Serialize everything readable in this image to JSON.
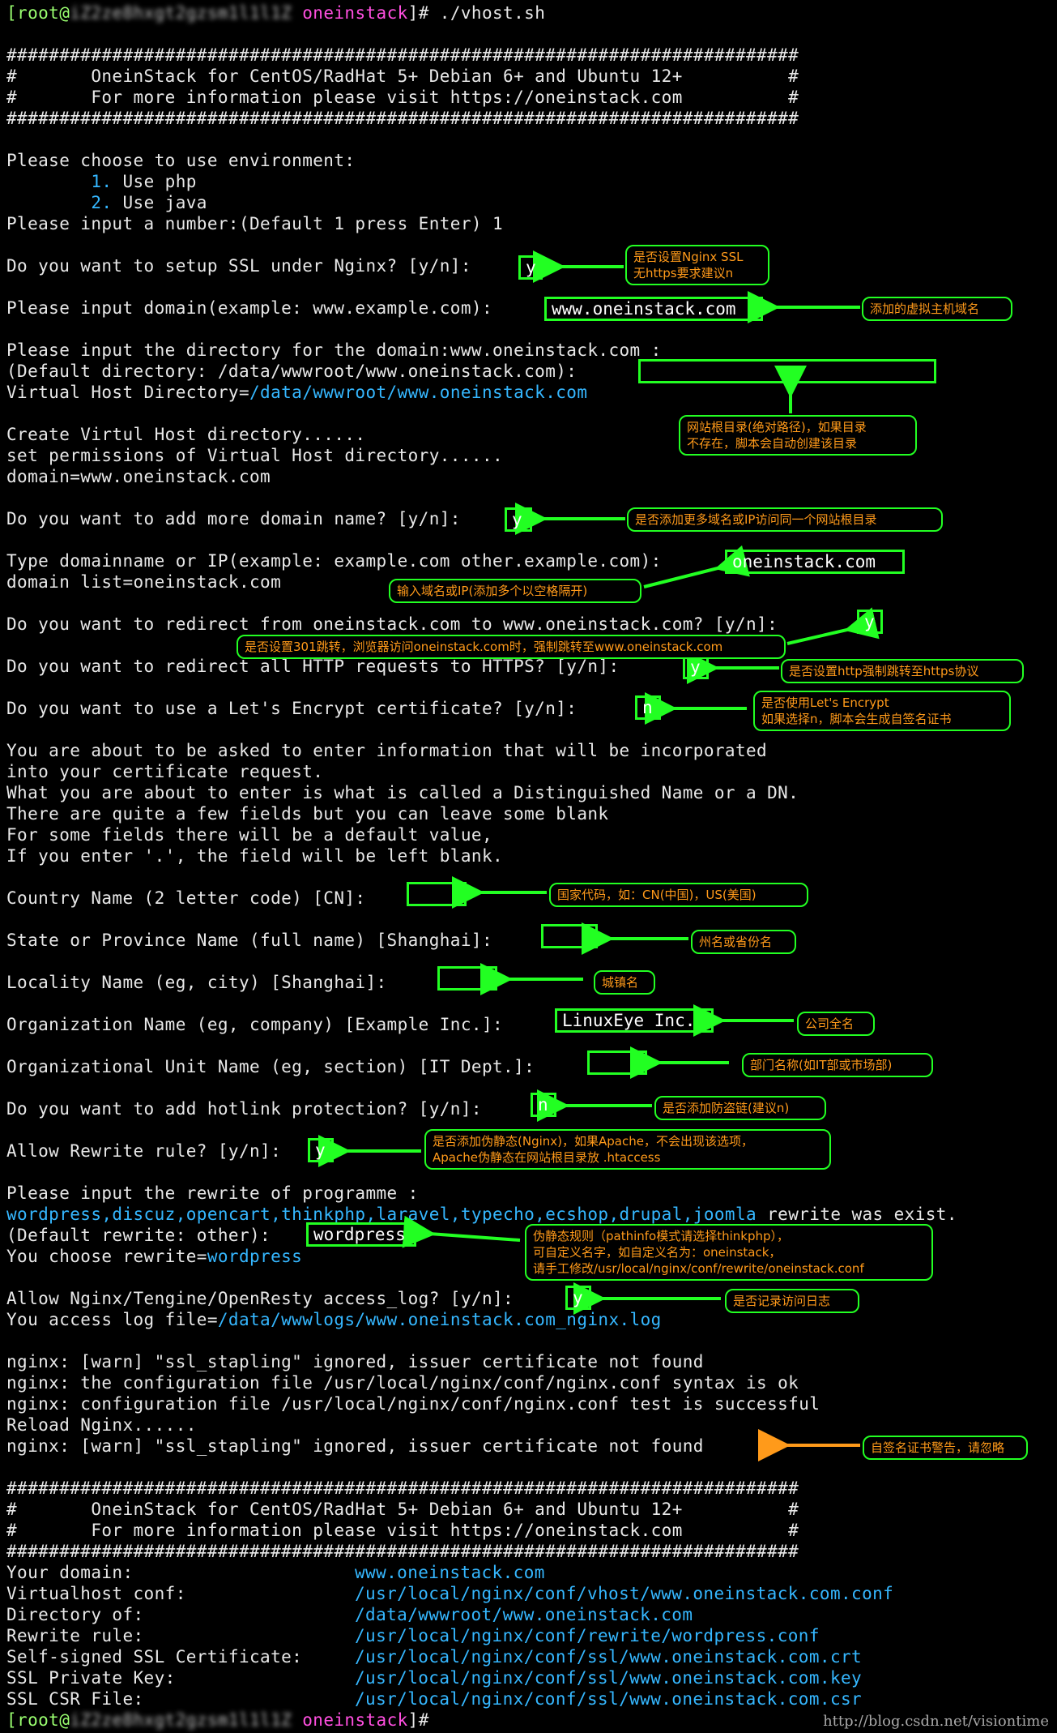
{
  "lines": [
    {
      "t": "p",
      "user": "root",
      "host_blur": "iZ2ze8hxgt2gzsm1l1l1Z",
      "host_name": "oneinstack",
      "cmd": "]# ./vhost.sh"
    },
    {
      "t": "x",
      "text": ""
    },
    {
      "t": "x",
      "text": "###########################################################################"
    },
    {
      "t": "x",
      "text": "#       OneinStack for CentOS/RadHat 5+ Debian 6+ and Ubuntu 12+          #"
    },
    {
      "t": "x",
      "text": "#       For more information please visit https://oneinstack.com          #"
    },
    {
      "t": "x",
      "text": "###########################################################################"
    },
    {
      "t": "x",
      "text": ""
    },
    {
      "t": "x",
      "text": "Please choose to use environment:"
    },
    {
      "t": "n",
      "pre": "        ",
      "num": "1.",
      "text": " Use php"
    },
    {
      "t": "n",
      "pre": "        ",
      "num": "2.",
      "text": " Use java"
    },
    {
      "t": "x",
      "text": "Please input a number:(Default 1 press Enter) 1"
    },
    {
      "t": "x",
      "text": ""
    },
    {
      "t": "x",
      "text": "Do you want to setup SSL under Nginx? [y/n]:"
    },
    {
      "t": "x",
      "text": ""
    },
    {
      "t": "x",
      "text": "Please input domain(example: www.example.com):"
    },
    {
      "t": "x",
      "text": ""
    },
    {
      "t": "x",
      "text": "Please input the directory for the domain:www.oneinstack.com :"
    },
    {
      "t": "x",
      "text": "(Default directory: /data/wwwroot/www.oneinstack.com):"
    },
    {
      "t": "c2",
      "text": "Virtual Host Directory=",
      "val": "/data/wwwroot/www.oneinstack.com"
    },
    {
      "t": "x",
      "text": ""
    },
    {
      "t": "x",
      "text": "Create Virtul Host directory......"
    },
    {
      "t": "x",
      "text": "set permissions of Virtual Host directory......"
    },
    {
      "t": "x",
      "text": "domain=www.oneinstack.com"
    },
    {
      "t": "x",
      "text": ""
    },
    {
      "t": "x",
      "text": "Do you want to add more domain name? [y/n]:"
    },
    {
      "t": "x",
      "text": ""
    },
    {
      "t": "x",
      "text": "Type domainname or IP(example: example.com other.example.com):"
    },
    {
      "t": "x",
      "text": "domain list=oneinstack.com"
    },
    {
      "t": "x",
      "text": ""
    },
    {
      "t": "x",
      "text": "Do you want to redirect from oneinstack.com to www.oneinstack.com? [y/n]:"
    },
    {
      "t": "x",
      "text": ""
    },
    {
      "t": "x",
      "text": "Do you want to redirect all HTTP requests to HTTPS? [y/n]:"
    },
    {
      "t": "x",
      "text": ""
    },
    {
      "t": "x",
      "text": "Do you want to use a Let's Encrypt certificate? [y/n]:"
    },
    {
      "t": "x",
      "text": ""
    },
    {
      "t": "x",
      "text": "You are about to be asked to enter information that will be incorporated"
    },
    {
      "t": "x",
      "text": "into your certificate request."
    },
    {
      "t": "x",
      "text": "What you are about to enter is what is called a Distinguished Name or a DN."
    },
    {
      "t": "x",
      "text": "There are quite a few fields but you can leave some blank"
    },
    {
      "t": "x",
      "text": "For some fields there will be a default value,"
    },
    {
      "t": "x",
      "text": "If you enter '.', the field will be left blank."
    },
    {
      "t": "x",
      "text": ""
    },
    {
      "t": "x",
      "text": "Country Name (2 letter code) [CN]:"
    },
    {
      "t": "x",
      "text": ""
    },
    {
      "t": "x",
      "text": "State or Province Name (full name) [Shanghai]:"
    },
    {
      "t": "x",
      "text": ""
    },
    {
      "t": "x",
      "text": "Locality Name (eg, city) [Shanghai]:"
    },
    {
      "t": "x",
      "text": ""
    },
    {
      "t": "x",
      "text": "Organization Name (eg, company) [Example Inc.]:"
    },
    {
      "t": "x",
      "text": ""
    },
    {
      "t": "x",
      "text": "Organizational Unit Name (eg, section) [IT Dept.]:"
    },
    {
      "t": "x",
      "text": ""
    },
    {
      "t": "x",
      "text": "Do you want to add hotlink protection? [y/n]:"
    },
    {
      "t": "x",
      "text": ""
    },
    {
      "t": "x",
      "text": "Allow Rewrite rule? [y/n]:"
    },
    {
      "t": "x",
      "text": ""
    },
    {
      "t": "x",
      "text": "Please input the rewrite of programme :"
    },
    {
      "t": "rw",
      "list": "wordpress,discuz,opencart,thinkphp,laravel,typecho,ecshop,drupal,joomla",
      "text": " rewrite was exist."
    },
    {
      "t": "x",
      "text": "(Default rewrite: other):"
    },
    {
      "t": "c2",
      "text": "You choose rewrite=",
      "val": "wordpress"
    },
    {
      "t": "x",
      "text": ""
    },
    {
      "t": "x",
      "text": "Allow Nginx/Tengine/OpenResty access_log? [y/n]:"
    },
    {
      "t": "c2",
      "text": "You access log file=",
      "val": "/data/wwwlogs/www.oneinstack.com_nginx.log"
    },
    {
      "t": "x",
      "text": ""
    },
    {
      "t": "x",
      "text": "nginx: [warn] \"ssl_stapling\" ignored, issuer certificate not found"
    },
    {
      "t": "x",
      "text": "nginx: the configuration file /usr/local/nginx/conf/nginx.conf syntax is ok"
    },
    {
      "t": "x",
      "text": "nginx: configuration file /usr/local/nginx/conf/nginx.conf test is successful"
    },
    {
      "t": "x",
      "text": "Reload Nginx......"
    },
    {
      "t": "x",
      "text": "nginx: [warn] \"ssl_stapling\" ignored, issuer certificate not found"
    },
    {
      "t": "x",
      "text": ""
    },
    {
      "t": "x",
      "text": "###########################################################################"
    },
    {
      "t": "x",
      "text": "#       OneinStack for CentOS/RadHat 5+ Debian 6+ and Ubuntu 12+          #"
    },
    {
      "t": "x",
      "text": "#       For more information please visit https://oneinstack.com          #"
    },
    {
      "t": "x",
      "text": "###########################################################################"
    },
    {
      "t": "kv",
      "k": "Your domain:",
      "v": "www.oneinstack.com"
    },
    {
      "t": "kv",
      "k": "Virtualhost conf:",
      "v": "/usr/local/nginx/conf/vhost/www.oneinstack.com.conf"
    },
    {
      "t": "kv",
      "k": "Directory of:",
      "v": "/data/wwwroot/www.oneinstack.com"
    },
    {
      "t": "kv",
      "k": "Rewrite rule:",
      "v": "/usr/local/nginx/conf/rewrite/wordpress.conf"
    },
    {
      "t": "kv",
      "k": "Self-signed SSL Certificate:",
      "v": "/usr/local/nginx/conf/ssl/www.oneinstack.com.crt"
    },
    {
      "t": "kv",
      "k": "SSL Private Key:",
      "v": "/usr/local/nginx/conf/ssl/www.oneinstack.com.key"
    },
    {
      "t": "kv",
      "k": "SSL CSR File:",
      "v": "/usr/local/nginx/conf/ssl/www.oneinstack.com.csr"
    },
    {
      "t": "p",
      "user": "root",
      "host_blur": "iZ2ze8hxgt2gzsm1l1l1Z",
      "host_name": "oneinstack",
      "cmd": "]#"
    }
  ],
  "inputs": {
    "ssl": "y",
    "domain": "www.oneinstack.com",
    "directory": "",
    "more_domain": "y",
    "domain_list": "oneinstack.com",
    "redirect_www": "y",
    "redirect_https": "y",
    "letsencrypt": "n",
    "country": "",
    "state": "",
    "locality": "",
    "organization": "LinuxEye Inc.",
    "org_unit": "",
    "hotlink": "n",
    "rewrite_allow": "y",
    "rewrite_program": "wordpress",
    "access_log": "y"
  },
  "notes": {
    "ssl": "是否设置Nginx SSL\n无https要求建议n",
    "domain": "添加的虚拟主机域名",
    "directory": "网站根目录(绝对路径)，如果目录\n不存在，脚本会自动创建该目录",
    "more_domain": "是否添加更多域名或IP访问同一个网站根目录",
    "domain_list": "输入域名或IP(添加多个以空格隔开)",
    "redirect_www": "是否设置301跳转，浏览器访问oneinstack.com时，强制跳转至www.oneinstack.com",
    "redirect_https": "是否设置http强制跳转至https协议",
    "letsencrypt": "是否使用Let's Encrypt\n如果选择n，脚本会生成自签名证书",
    "country": "国家代码，如：CN(中国)，US(美国)",
    "state": "州名或省份名",
    "locality": "城镇名",
    "organization": "公司全名",
    "org_unit": "部门名称(如IT部或市场部)",
    "hotlink": "是否添加防盗链(建议n)",
    "rewrite_allow": "是否添加伪静态(Nginx)，如果Apache，不会出现该选项，\nApache伪静态在网站根目录放 .htaccess",
    "rewrite_program": "伪静态规则（pathinfo模式请选择thinkphp），\n可自定义名字，如自定义名为：oneinstack，\n请手工修改/usr/local/nginx/conf/rewrite/oneinstack.conf",
    "access_log": "是否记录访问日志",
    "ssl_warn": "自签名证书警告，请忽略"
  },
  "colors": {
    "prompt_green": "#9aff70",
    "host_magenta": "#ff4fe0",
    "path_cyan": "#35b7ff",
    "annotation_green": "#22ff22",
    "note_orange": "#ff9a1a"
  },
  "watermark": "http://blog.csdn.net/visiontime"
}
